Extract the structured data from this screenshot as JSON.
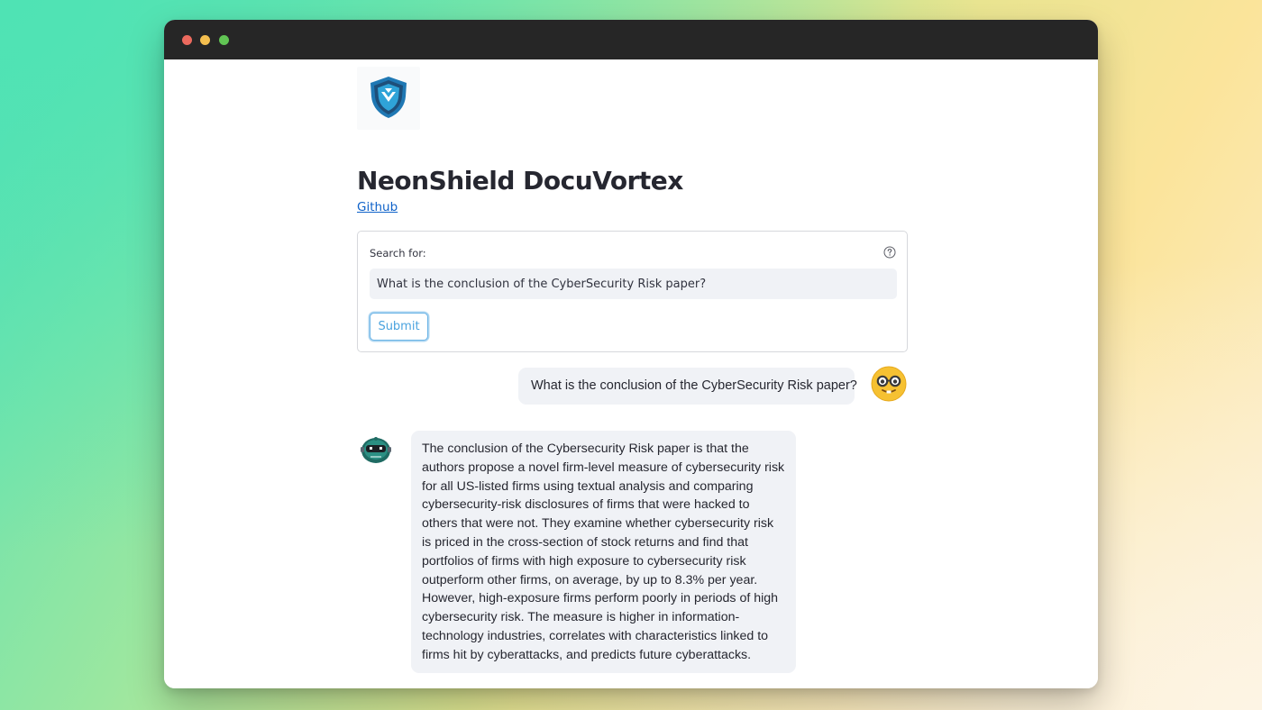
{
  "app": {
    "title": "NeonShield DocuVortex",
    "github_label": "Github"
  },
  "form": {
    "label": "Search for:",
    "input_value": "What is the conclusion of the CyberSecurity Risk paper?",
    "submit_label": "Submit"
  },
  "chat": {
    "user_message": "What is the conclusion of the CyberSecurity Risk paper?",
    "bot_message": "The conclusion of the Cybersecurity Risk paper is that the authors propose a novel firm-level measure of cybersecurity risk for all US-listed firms using textual analysis and comparing cybersecurity-risk disclosures of firms that were hacked to others that were not. They examine whether cybersecurity risk is priced in the cross-section of stock returns and find that portfolios of firms with high exposure to cybersecurity risk outperform other firms, on average, by up to 8.3% per year. However, high-exposure firms perform poorly in periods of high cybersecurity risk. The measure is higher in information-technology industries, correlates with characteristics linked to firms hit by cyberattacks, and predicts future cyberattacks."
  },
  "icons": {
    "logo": "shield-logo",
    "help": "question-circle-icon",
    "user_avatar": "nerd-face-emoji",
    "bot_avatar": "robot-face-icon"
  },
  "colors": {
    "titlebar": "#262626",
    "accent": "#4aa3df",
    "link": "#0f62c9",
    "bubble": "#f0f2f6",
    "shield": "#1b6fa8"
  }
}
